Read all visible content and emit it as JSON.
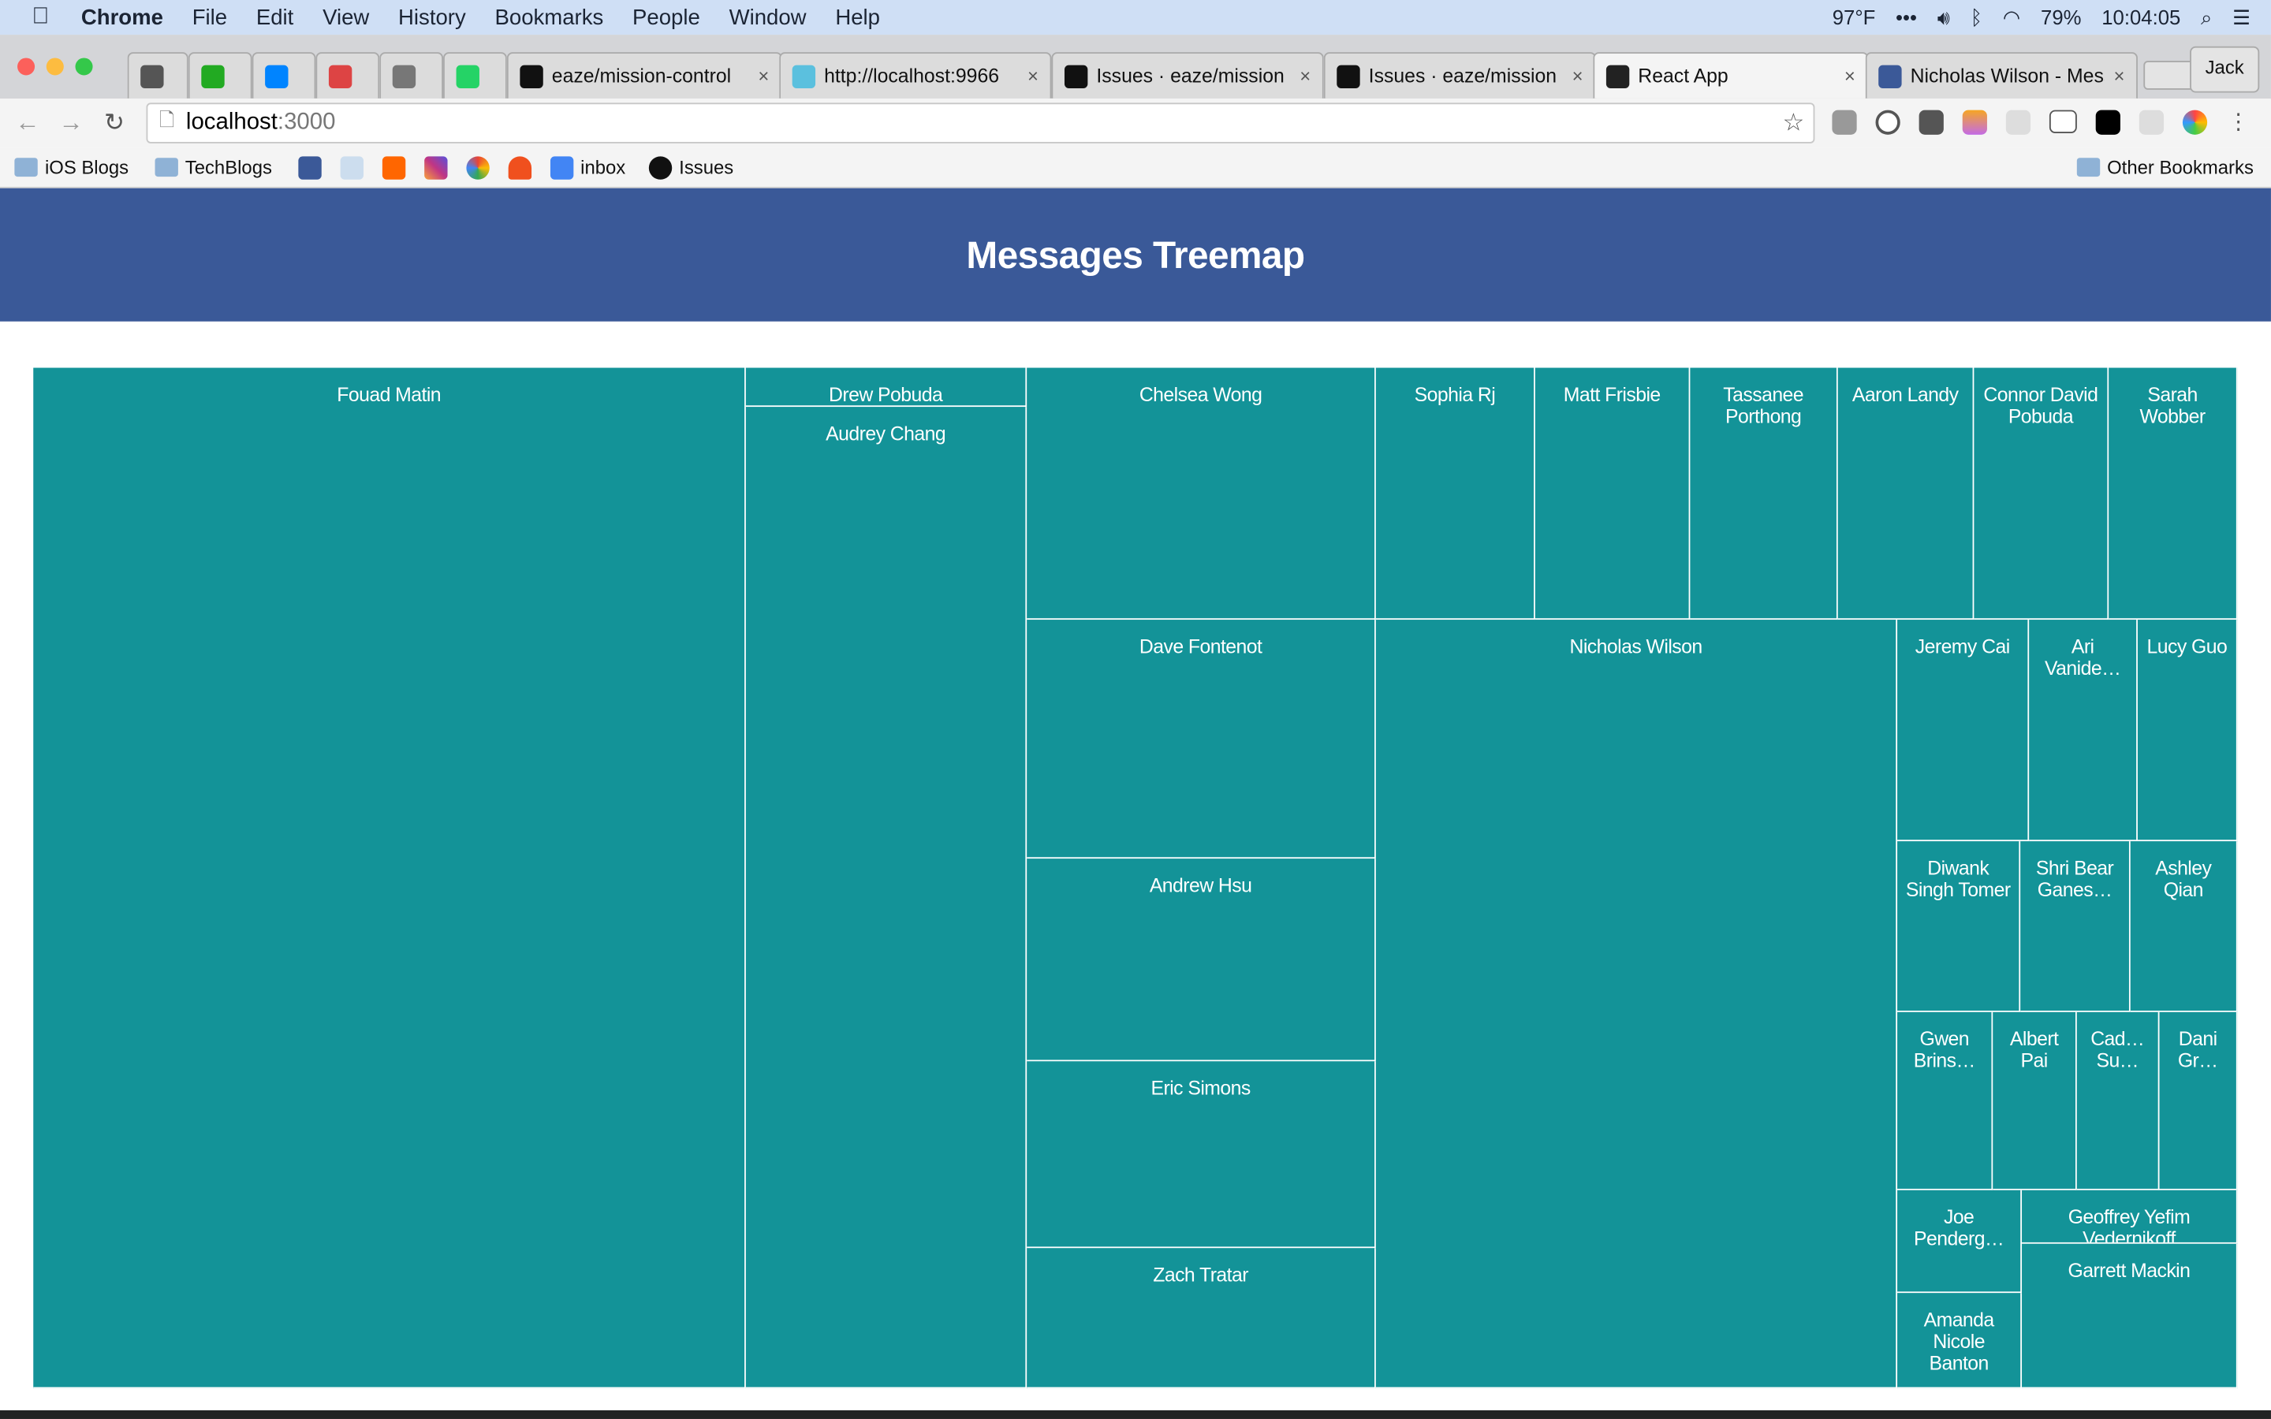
{
  "menubar": {
    "app": "Chrome",
    "items": [
      "File",
      "Edit",
      "View",
      "History",
      "Bookmarks",
      "People",
      "Window",
      "Help"
    ],
    "temperature": "97°F",
    "battery": "79%",
    "time": "10:04:05"
  },
  "tabs": [
    {
      "label": "",
      "icon": "sigma-icon"
    },
    {
      "label": "",
      "icon": "check-icon"
    },
    {
      "label": "",
      "icon": "messenger-icon"
    },
    {
      "label": "",
      "icon": "gmail-icon"
    },
    {
      "label": "",
      "icon": "speaker-icon"
    },
    {
      "label": "",
      "icon": "whatsapp-icon"
    },
    {
      "label": "eaze/mission-control",
      "icon": "github-icon"
    },
    {
      "label": "http://localhost:9966",
      "icon": "e-icon"
    },
    {
      "label": "Issues · eaze/mission",
      "icon": "github-icon"
    },
    {
      "label": "Issues · eaze/mission",
      "icon": "github-icon"
    },
    {
      "label": "React App",
      "icon": "react-icon"
    },
    {
      "label": "Nicholas Wilson - Messenger",
      "icon": "facebook-icon"
    }
  ],
  "profile": "Jack",
  "address": {
    "host": "localhost",
    "port": ":3000"
  },
  "bookmarks": {
    "folders": [
      "iOS Blogs",
      "TechBlogs"
    ],
    "inbox": "inbox",
    "issues": "Issues",
    "other": "Other Bookmarks"
  },
  "page": {
    "title": "Messages Treemap"
  },
  "colors": {
    "header": "#3a5998",
    "cell": "#139398"
  },
  "chart_data": {
    "type": "treemap",
    "title": "Messages Treemap",
    "labels": [
      "Fouad Matin",
      "Drew Pobuda",
      "Audrey Chang",
      "Chelsea Wong",
      "Sophia Rj",
      "Matt Frisbie",
      "Tassanee Porthong",
      "Aaron Landy",
      "Connor David Pobuda",
      "Sarah Wobber",
      "Dave Fontenot",
      "Andrew Hsu",
      "Eric Simons",
      "Zach Tratar",
      "Nicholas Wilson",
      "Jeremy Cai",
      "Ari Vanide…",
      "Lucy Guo",
      "Diwank Singh Tomer",
      "Shri Bear Ganes…",
      "Ashley Qian",
      "Gwen Brins…",
      "Albert Pai",
      "Cad… Su…",
      "Dani Gr…",
      "Joe Penderg…",
      "Amanda Nicole Banton",
      "Geoffrey Yefim Vedernikoff",
      "Garrett Mackin"
    ]
  }
}
